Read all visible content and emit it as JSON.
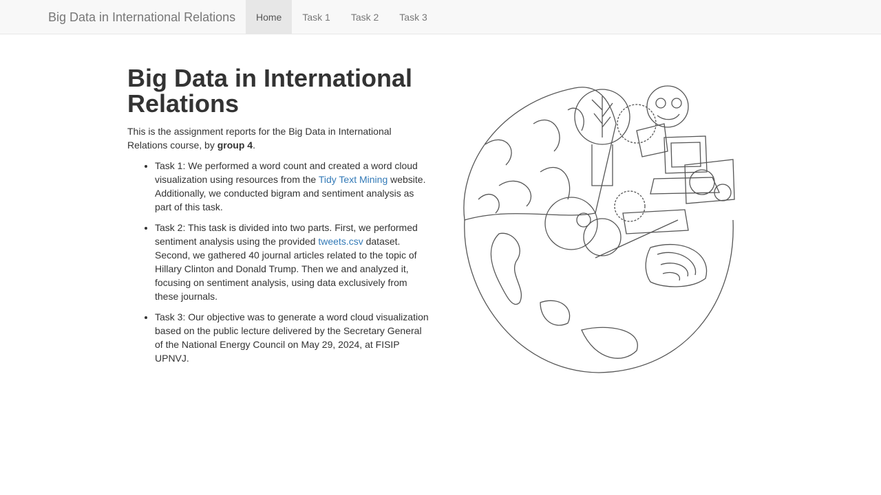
{
  "navbar": {
    "brand": "Big Data in International Relations",
    "tabs": [
      {
        "label": "Home",
        "active": true
      },
      {
        "label": "Task 1",
        "active": false
      },
      {
        "label": "Task 2",
        "active": false
      },
      {
        "label": "Task 3",
        "active": false
      }
    ]
  },
  "main": {
    "title": "Big Data in International Relations",
    "intro": {
      "before": "This is the assignment reports for the Big Data in International Relations course, by ",
      "bold": "group 4",
      "after": "."
    },
    "tasks": [
      {
        "before": "Task 1: We performed a word count and created a word cloud visualization using resources from the ",
        "link": "Tidy Text Mining",
        "after": " website. Additionally, we conducted bigram and sentiment analysis as part of this task."
      },
      {
        "before": "Task 2: This task is divided into two parts. First, we performed sentiment analysis using the provided ",
        "link": "tweets.csv",
        "after": " dataset. Second, we gathered 40 journal articles related to the topic of Hillary Clinton and Donald Trump. Then we and analyzed it, focusing on sentiment analysis, using data exclusively from these journals."
      },
      {
        "text": "Task 3: Our objective was to generate a word cloud visualization based on the public lecture delivered by the Secretary General of the National Energy Council on May 29, 2024, at FISIP UPNVJ."
      }
    ]
  },
  "colors": {
    "link": "#337ab7",
    "navbar_bg": "#f8f8f8",
    "active_tab_bg": "#e7e7e7",
    "text": "#333333"
  }
}
